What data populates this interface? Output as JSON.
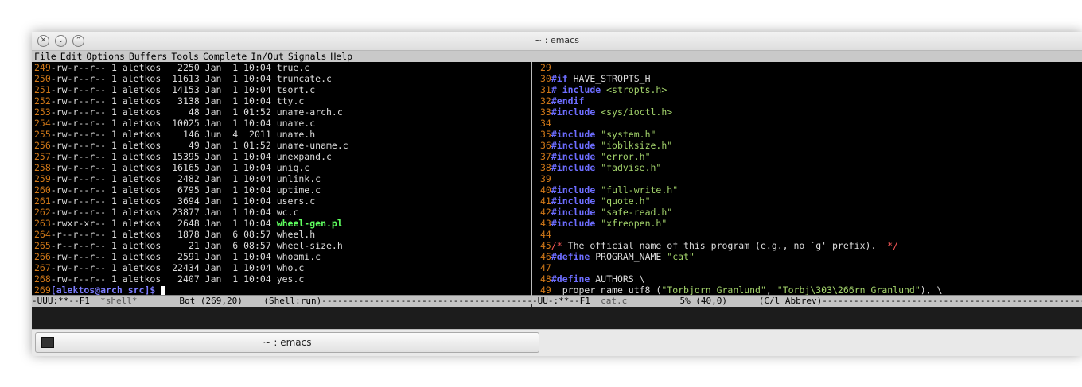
{
  "window": {
    "title": "~ : emacs"
  },
  "menu": [
    "File",
    "Edit",
    "Options",
    "Buffers",
    "Tools",
    "Complete",
    "In/Out",
    "Signals",
    "Help"
  ],
  "shell": {
    "rows": [
      {
        "n": "249",
        "perm": "-rw-r--r--",
        "links": "1",
        "owner": "aletkos",
        "size": "2250",
        "month": "Jan",
        "day": "1",
        "time": "10:04",
        "name": "true.c"
      },
      {
        "n": "250",
        "perm": "-rw-r--r--",
        "links": "1",
        "owner": "aletkos",
        "size": "11613",
        "month": "Jan",
        "day": "1",
        "time": "10:04",
        "name": "truncate.c"
      },
      {
        "n": "251",
        "perm": "-rw-r--r--",
        "links": "1",
        "owner": "aletkos",
        "size": "14153",
        "month": "Jan",
        "day": "1",
        "time": "10:04",
        "name": "tsort.c"
      },
      {
        "n": "252",
        "perm": "-rw-r--r--",
        "links": "1",
        "owner": "aletkos",
        "size": "3138",
        "month": "Jan",
        "day": "1",
        "time": "10:04",
        "name": "tty.c"
      },
      {
        "n": "253",
        "perm": "-rw-r--r--",
        "links": "1",
        "owner": "aletkos",
        "size": "48",
        "month": "Jan",
        "day": "1",
        "time": "01:52",
        "name": "uname-arch.c"
      },
      {
        "n": "254",
        "perm": "-rw-r--r--",
        "links": "1",
        "owner": "aletkos",
        "size": "10025",
        "month": "Jan",
        "day": "1",
        "time": "10:04",
        "name": "uname.c"
      },
      {
        "n": "255",
        "perm": "-rw-r--r--",
        "links": "1",
        "owner": "aletkos",
        "size": "146",
        "month": "Jun",
        "day": "4",
        "time": "2011",
        "name": "uname.h"
      },
      {
        "n": "256",
        "perm": "-rw-r--r--",
        "links": "1",
        "owner": "aletkos",
        "size": "49",
        "month": "Jan",
        "day": "1",
        "time": "01:52",
        "name": "uname-uname.c"
      },
      {
        "n": "257",
        "perm": "-rw-r--r--",
        "links": "1",
        "owner": "aletkos",
        "size": "15395",
        "month": "Jan",
        "day": "1",
        "time": "10:04",
        "name": "unexpand.c"
      },
      {
        "n": "258",
        "perm": "-rw-r--r--",
        "links": "1",
        "owner": "aletkos",
        "size": "16165",
        "month": "Jan",
        "day": "1",
        "time": "10:04",
        "name": "uniq.c"
      },
      {
        "n": "259",
        "perm": "-rw-r--r--",
        "links": "1",
        "owner": "aletkos",
        "size": "2482",
        "month": "Jan",
        "day": "1",
        "time": "10:04",
        "name": "unlink.c"
      },
      {
        "n": "260",
        "perm": "-rw-r--r--",
        "links": "1",
        "owner": "aletkos",
        "size": "6795",
        "month": "Jan",
        "day": "1",
        "time": "10:04",
        "name": "uptime.c"
      },
      {
        "n": "261",
        "perm": "-rw-r--r--",
        "links": "1",
        "owner": "aletkos",
        "size": "3694",
        "month": "Jan",
        "day": "1",
        "time": "10:04",
        "name": "users.c"
      },
      {
        "n": "262",
        "perm": "-rw-r--r--",
        "links": "1",
        "owner": "aletkos",
        "size": "23877",
        "month": "Jan",
        "day": "1",
        "time": "10:04",
        "name": "wc.c"
      },
      {
        "n": "263",
        "perm": "-rwxr-xr--",
        "links": "1",
        "owner": "aletkos",
        "size": "2648",
        "month": "Jan",
        "day": "1",
        "time": "10:04",
        "name": "wheel-gen.pl",
        "exec": true
      },
      {
        "n": "264",
        "perm": "-r--r--r--",
        "links": "1",
        "owner": "aletkos",
        "size": "1878",
        "month": "Jan",
        "day": "6",
        "time": "08:57",
        "name": "wheel.h"
      },
      {
        "n": "265",
        "perm": "-r--r--r--",
        "links": "1",
        "owner": "aletkos",
        "size": "21",
        "month": "Jan",
        "day": "6",
        "time": "08:57",
        "name": "wheel-size.h"
      },
      {
        "n": "266",
        "perm": "-rw-r--r--",
        "links": "1",
        "owner": "aletkos",
        "size": "2591",
        "month": "Jan",
        "day": "1",
        "time": "10:04",
        "name": "whoami.c"
      },
      {
        "n": "267",
        "perm": "-rw-r--r--",
        "links": "1",
        "owner": "aletkos",
        "size": "22434",
        "month": "Jan",
        "day": "1",
        "time": "10:04",
        "name": "who.c"
      },
      {
        "n": "268",
        "perm": "-rw-r--r--",
        "links": "1",
        "owner": "aletkos",
        "size": "2407",
        "month": "Jan",
        "day": "1",
        "time": "10:04",
        "name": "yes.c"
      }
    ],
    "prompt_n": "269",
    "prompt": "[alektos@arch src]$ "
  },
  "code": {
    "lines": [
      {
        "n": "29",
        "seg": []
      },
      {
        "n": "30",
        "seg": [
          {
            "t": "#if",
            "c": "kw"
          },
          {
            "t": " HAVE_STROPTS_H"
          }
        ]
      },
      {
        "n": "31",
        "seg": [
          {
            "t": "# include",
            "c": "kw"
          },
          {
            "t": " "
          },
          {
            "t": "<stropts.h>",
            "c": "str"
          }
        ]
      },
      {
        "n": "32",
        "seg": [
          {
            "t": "#endif",
            "c": "kw"
          }
        ]
      },
      {
        "n": "33",
        "seg": [
          {
            "t": "#include",
            "c": "kw"
          },
          {
            "t": " "
          },
          {
            "t": "<sys/ioctl.h>",
            "c": "str"
          }
        ]
      },
      {
        "n": "34",
        "seg": []
      },
      {
        "n": "35",
        "seg": [
          {
            "t": "#include",
            "c": "kw"
          },
          {
            "t": " "
          },
          {
            "t": "\"system.h\"",
            "c": "str"
          }
        ]
      },
      {
        "n": "36",
        "seg": [
          {
            "t": "#include",
            "c": "kw"
          },
          {
            "t": " "
          },
          {
            "t": "\"ioblksize.h\"",
            "c": "str"
          }
        ]
      },
      {
        "n": "37",
        "seg": [
          {
            "t": "#include",
            "c": "kw"
          },
          {
            "t": " "
          },
          {
            "t": "\"error.h\"",
            "c": "str"
          }
        ]
      },
      {
        "n": "38",
        "seg": [
          {
            "t": "#include",
            "c": "kw"
          },
          {
            "t": " "
          },
          {
            "t": "\"fadvise.h\"",
            "c": "str"
          }
        ]
      },
      {
        "n": "39",
        "seg": []
      },
      {
        "n": "40",
        "seg": [
          {
            "t": "#include",
            "c": "kw"
          },
          {
            "t": " "
          },
          {
            "t": "\"full-write.h\"",
            "c": "str"
          }
        ]
      },
      {
        "n": "41",
        "seg": [
          {
            "t": "#include",
            "c": "kw"
          },
          {
            "t": " "
          },
          {
            "t": "\"quote.h\"",
            "c": "str"
          }
        ]
      },
      {
        "n": "42",
        "seg": [
          {
            "t": "#include",
            "c": "kw"
          },
          {
            "t": " "
          },
          {
            "t": "\"safe-read.h\"",
            "c": "str"
          }
        ]
      },
      {
        "n": "43",
        "seg": [
          {
            "t": "#include",
            "c": "kw"
          },
          {
            "t": " "
          },
          {
            "t": "\"xfreopen.h\"",
            "c": "str"
          }
        ]
      },
      {
        "n": "44",
        "seg": []
      },
      {
        "n": "45",
        "seg": [
          {
            "t": "/*",
            "c": "cmt"
          },
          {
            "t": " The official name of this program (e.g., no `g' prefix).  "
          },
          {
            "t": "*/",
            "c": "cmt"
          }
        ]
      },
      {
        "n": "46",
        "seg": [
          {
            "t": "#define",
            "c": "kw"
          },
          {
            "t": " PROGRAM_NAME "
          },
          {
            "t": "\"cat\"",
            "c": "str"
          }
        ]
      },
      {
        "n": "47",
        "seg": []
      },
      {
        "n": "48",
        "seg": [
          {
            "t": "#define",
            "c": "kw"
          },
          {
            "t": " AUTHORS \\"
          }
        ]
      },
      {
        "n": "49",
        "seg": [
          {
            "t": "  proper_name_utf8 ("
          },
          {
            "t": "\"Torbjorn Granlund\"",
            "c": "str"
          },
          {
            "t": ", "
          },
          {
            "t": "\"Torbj\\303\\266rn Granlund\"",
            "c": "str"
          },
          {
            "t": "), \\"
          }
        ]
      }
    ]
  },
  "modeline_left": {
    "pre": "-UUU:**--F1  ",
    "buf": "*shell*",
    "post": "        Bot (269,20)    (Shell:run)-------------------------------------------------------------------"
  },
  "modeline_right": {
    "pre": "-UU-:**--F1  ",
    "buf": "cat.c",
    "post": "          5% (40,0)      (C/l Abbrev)-------------------------------------------------------------------------"
  },
  "taskbar": {
    "title": "~ : emacs"
  }
}
